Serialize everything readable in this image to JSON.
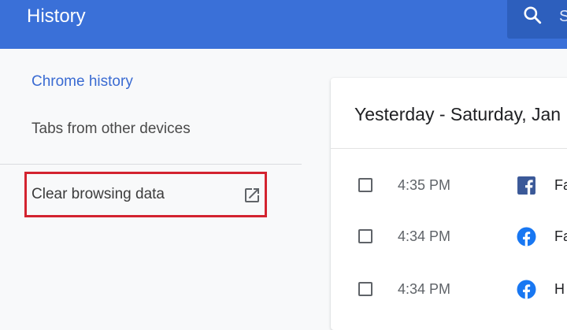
{
  "header": {
    "title": "History",
    "search_icon": "search-icon",
    "search_hint": "S"
  },
  "sidebar": {
    "items": [
      {
        "label": "Chrome history",
        "selected": true
      },
      {
        "label": "Tabs from other devices",
        "selected": false
      }
    ],
    "clear_browsing": {
      "label": "Clear browsing data",
      "icon": "external-link-icon",
      "highlight_color": "#d3232f"
    }
  },
  "history": {
    "date_header": "Yesterday - Saturday, Jan",
    "entries": [
      {
        "time": "4:35 PM",
        "favicon": "facebook-square-icon",
        "title": "Fa"
      },
      {
        "time": "4:34 PM",
        "favicon": "facebook-round-icon",
        "title": "Fa"
      },
      {
        "time": "4:34 PM",
        "favicon": "facebook-round-icon",
        "title": "H"
      }
    ]
  },
  "colors": {
    "header_bg": "#3a70d8",
    "accent": "#3a6bd2",
    "facebook_blue": "#1877f2"
  }
}
